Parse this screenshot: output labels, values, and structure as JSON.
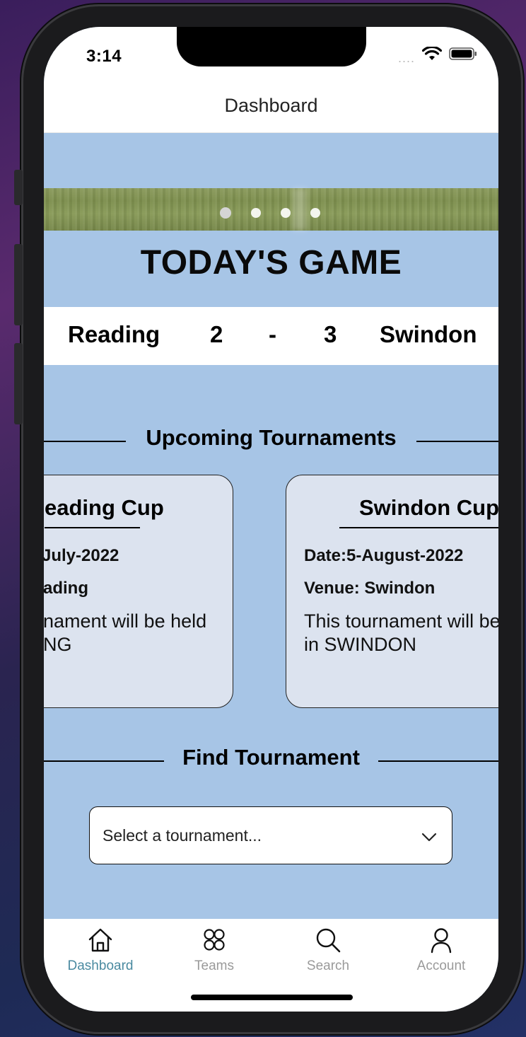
{
  "status_bar": {
    "time": "3:14",
    "signal_dots": "....",
    "icons": [
      "wifi-icon",
      "battery-icon"
    ]
  },
  "header": {
    "title": "Dashboard"
  },
  "carousel": {
    "page_count": 4,
    "active_index": 0
  },
  "todays_game": {
    "heading": "TODAY'S GAME",
    "home_team": "Reading",
    "home_score": "2",
    "separator": "-",
    "away_score": "3",
    "away_team": "Swindon"
  },
  "upcoming": {
    "heading": "Upcoming Tournaments",
    "cards": [
      {
        "title": "eading Cup",
        "date": "July-2022",
        "venue": "ading",
        "desc_line1": "nament will be held",
        "desc_line2": "NG"
      },
      {
        "title": "Swindon Cup",
        "date": "Date:5-August-2022",
        "venue": "Venue: Swindon",
        "desc_line1": "This tournament will be",
        "desc_line2": "in SWINDON"
      }
    ]
  },
  "find": {
    "heading": "Find Tournament",
    "select_placeholder": "Select a tournament..."
  },
  "tabs": [
    {
      "label": "Dashboard",
      "icon": "home-icon",
      "active": true
    },
    {
      "label": "Teams",
      "icon": "teams-icon",
      "active": false
    },
    {
      "label": "Search",
      "icon": "search-icon",
      "active": false
    },
    {
      "label": "Account",
      "icon": "account-icon",
      "active": false
    }
  ],
  "colors": {
    "background": "#a7c5e6",
    "card": "#dce3ef",
    "active_tab": "#4a8aa0",
    "inactive_tab": "#9a9a9a"
  }
}
